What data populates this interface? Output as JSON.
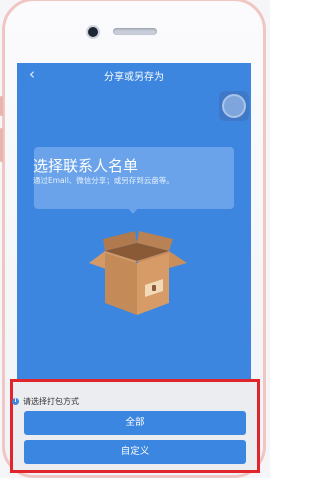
{
  "header": {
    "back_glyph": "‹",
    "title": "分享或另存为"
  },
  "tip": {
    "title": "选择联系人名单",
    "description": "通过Email、微信分享；或另存到云盘等。"
  },
  "panel": {
    "hint": "请选择打包方式",
    "buttons": [
      {
        "label": "全部"
      },
      {
        "label": "自定义"
      }
    ]
  },
  "colors": {
    "screen_background": "#3c86df",
    "button_blue": "#3a86e0",
    "highlight_border": "#e0262c",
    "tip_bubble": "#6aa3ea",
    "phone_rim": "#f0c6c2"
  },
  "icons": {
    "back": "chevron-left-icon",
    "floating": "assistive-touch-icon",
    "info": "info-icon",
    "illustration": "open-cardboard-box"
  }
}
